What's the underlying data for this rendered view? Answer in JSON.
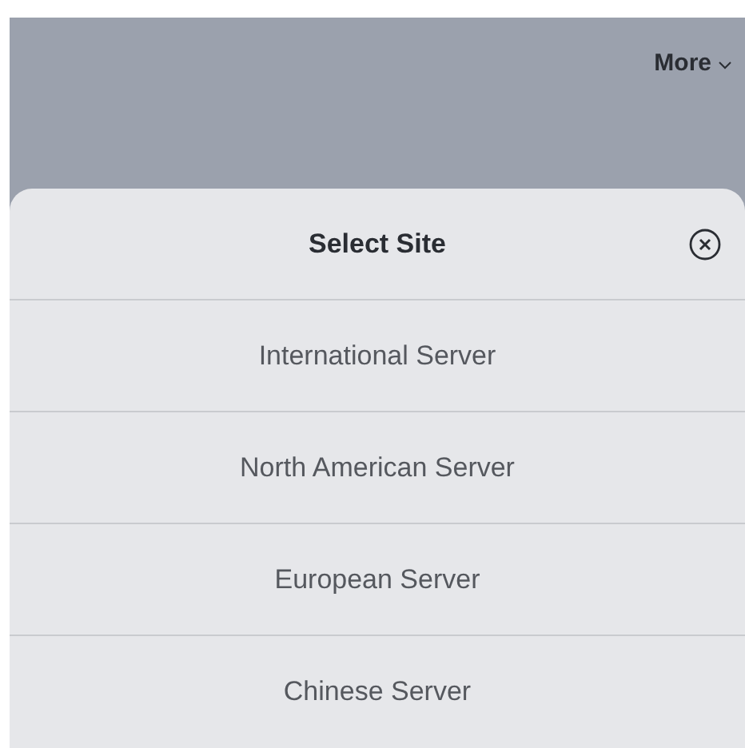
{
  "top_bar": {
    "menu_label": "More"
  },
  "sheet": {
    "title": "Select Site",
    "items": [
      {
        "label": "International Server"
      },
      {
        "label": "North American Server"
      },
      {
        "label": "European Server"
      },
      {
        "label": "Chinese Server"
      }
    ]
  }
}
